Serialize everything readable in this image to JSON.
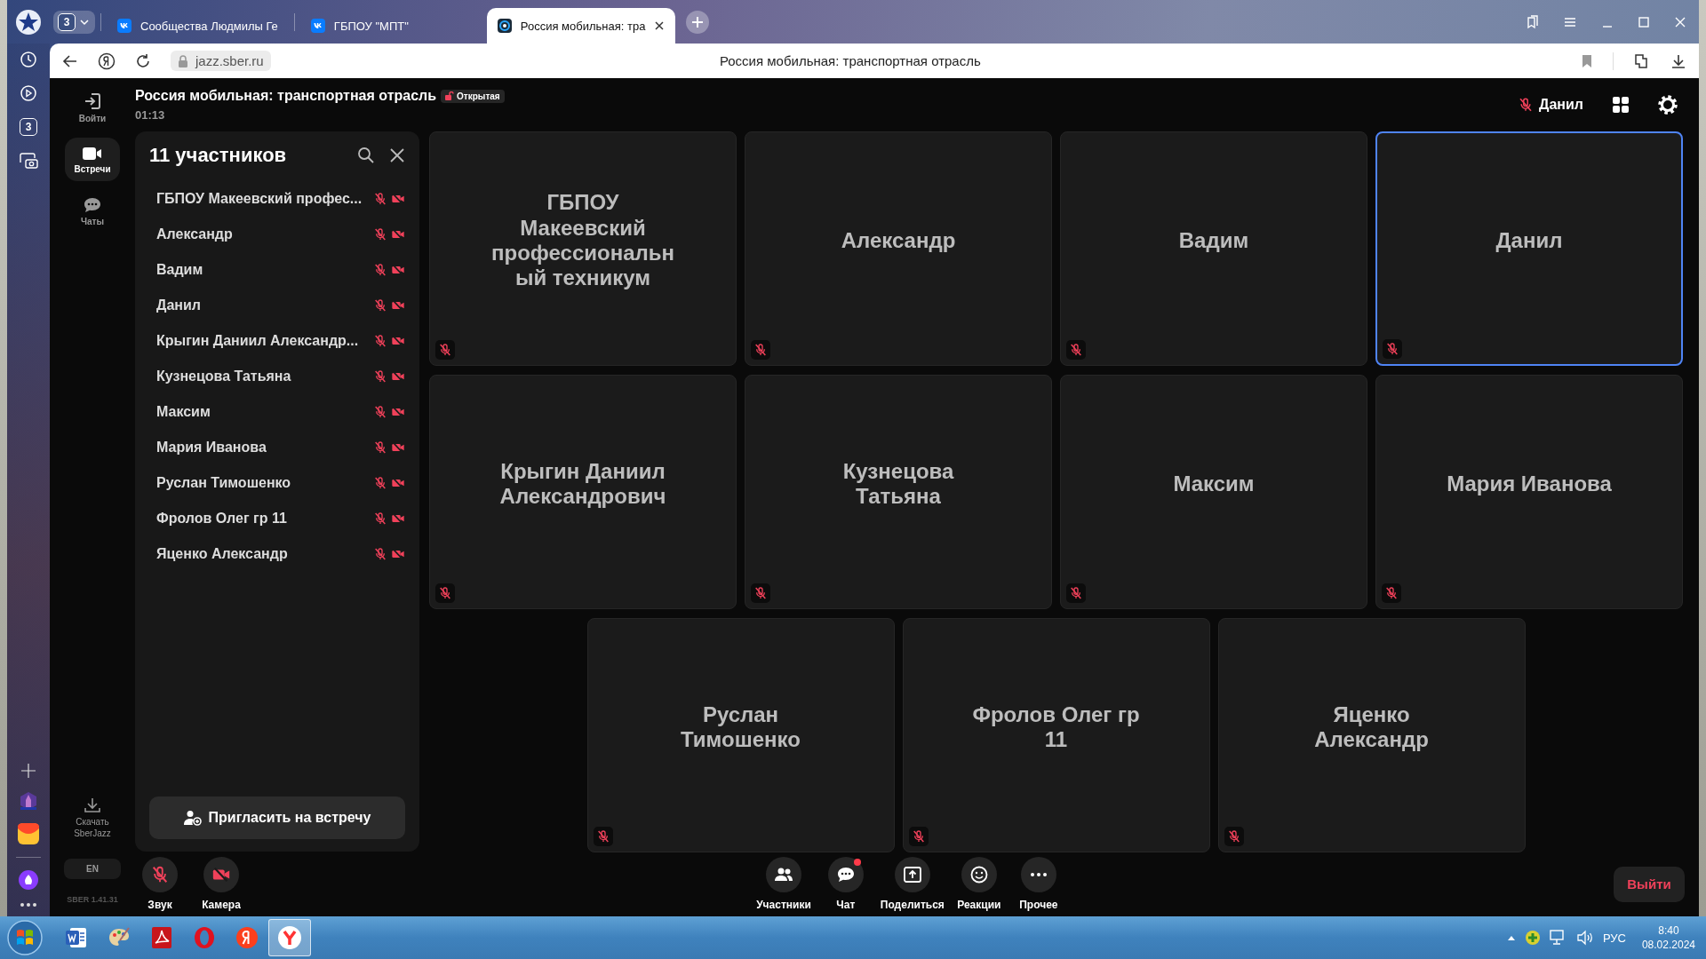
{
  "browser": {
    "tab_counter": "3",
    "tabs": [
      {
        "title": "Сообщества Людмилы Ге",
        "selected": false
      },
      {
        "title": "ГБПОУ \"МПТ\"",
        "selected": false
      },
      {
        "title": "Россия мобильная: тра",
        "selected": true
      }
    ],
    "address": "jazz.sber.ru",
    "page_title": "Россия мобильная: транспортная отрасль",
    "rail_counter": "3"
  },
  "meeting": {
    "title": "Россия мобильная: транспортная отрасль",
    "access": "Открытая",
    "timer": "01:13",
    "user": {
      "name": "Данил",
      "mic_muted": true
    }
  },
  "nav": {
    "items": [
      {
        "label": "Войти",
        "kind": "login",
        "selected": false
      },
      {
        "label": "Встречи",
        "kind": "meetings",
        "selected": true
      },
      {
        "label": "Чаты",
        "kind": "chats",
        "selected": false
      }
    ],
    "download": "Скачать SberJazz",
    "language": "EN",
    "version": "SBER 1.41.31"
  },
  "participants_panel": {
    "title": "11 участников",
    "participants": [
      {
        "name": "ГБПОУ Макеевский профес...",
        "mic_muted": true,
        "camera_off": true
      },
      {
        "name": "Александр",
        "mic_muted": true,
        "camera_off": true
      },
      {
        "name": "Вадим",
        "mic_muted": true,
        "camera_off": true
      },
      {
        "name": "Данил",
        "mic_muted": true,
        "camera_off": true
      },
      {
        "name": "Крыгин Даниил Александр...",
        "mic_muted": true,
        "camera_off": true
      },
      {
        "name": "Кузнецова Татьяна",
        "mic_muted": true,
        "camera_off": true
      },
      {
        "name": "Максим",
        "mic_muted": true,
        "camera_off": true
      },
      {
        "name": "Мария Иванова",
        "mic_muted": true,
        "camera_off": true
      },
      {
        "name": "Руслан Тимошенко",
        "mic_muted": true,
        "camera_off": true
      },
      {
        "name": "Фролов Олег гр 11",
        "mic_muted": true,
        "camera_off": true
      },
      {
        "name": "Яценко Александр",
        "mic_muted": true,
        "camera_off": true
      }
    ],
    "invite_button": "Пригласить на встречу"
  },
  "tiles": [
    {
      "name": "ГБПОУ Макеевский профессиональный техникум",
      "mic_muted": true,
      "highlighted": false
    },
    {
      "name": "Александр",
      "mic_muted": true,
      "highlighted": false
    },
    {
      "name": "Вадим",
      "mic_muted": true,
      "highlighted": false
    },
    {
      "name": "Данил",
      "mic_muted": true,
      "highlighted": true
    },
    {
      "name": "Крыгин Даниил Александрович",
      "mic_muted": true,
      "highlighted": false
    },
    {
      "name": "Кузнецова Татьяна",
      "mic_muted": true,
      "highlighted": false
    },
    {
      "name": "Максим",
      "mic_muted": true,
      "highlighted": false
    },
    {
      "name": "Мария Иванова",
      "mic_muted": true,
      "highlighted": false
    },
    {
      "name": "Руслан Тимошенко",
      "mic_muted": true,
      "highlighted": false
    },
    {
      "name": "Фролов Олег гр 11",
      "mic_muted": true,
      "highlighted": false
    },
    {
      "name": "Яценко Александр",
      "mic_muted": true,
      "highlighted": false
    }
  ],
  "controls": {
    "left": [
      {
        "label": "Звук",
        "kind": "mic",
        "off": true
      },
      {
        "label": "Камера",
        "kind": "camera",
        "off": true
      }
    ],
    "center": [
      {
        "label": "Участники",
        "kind": "people",
        "unread": false
      },
      {
        "label": "Чат",
        "kind": "chat",
        "unread": true
      },
      {
        "label": "Поделиться",
        "kind": "share",
        "unread": false
      },
      {
        "label": "Реакции",
        "kind": "reactions",
        "unread": false
      },
      {
        "label": "Прочее",
        "kind": "more",
        "unread": false
      }
    ],
    "leave_button": "Выйти"
  },
  "taskbar": {
    "apps": [
      {
        "kind": "word",
        "selected": false
      },
      {
        "kind": "paint",
        "selected": false
      },
      {
        "kind": "pdf",
        "selected": false
      },
      {
        "kind": "opera",
        "selected": false
      },
      {
        "kind": "yandex",
        "selected": false
      },
      {
        "kind": "yandex-browser",
        "selected": true
      }
    ],
    "language": "РУС",
    "time": "8:40",
    "date": "08.02.2024"
  }
}
